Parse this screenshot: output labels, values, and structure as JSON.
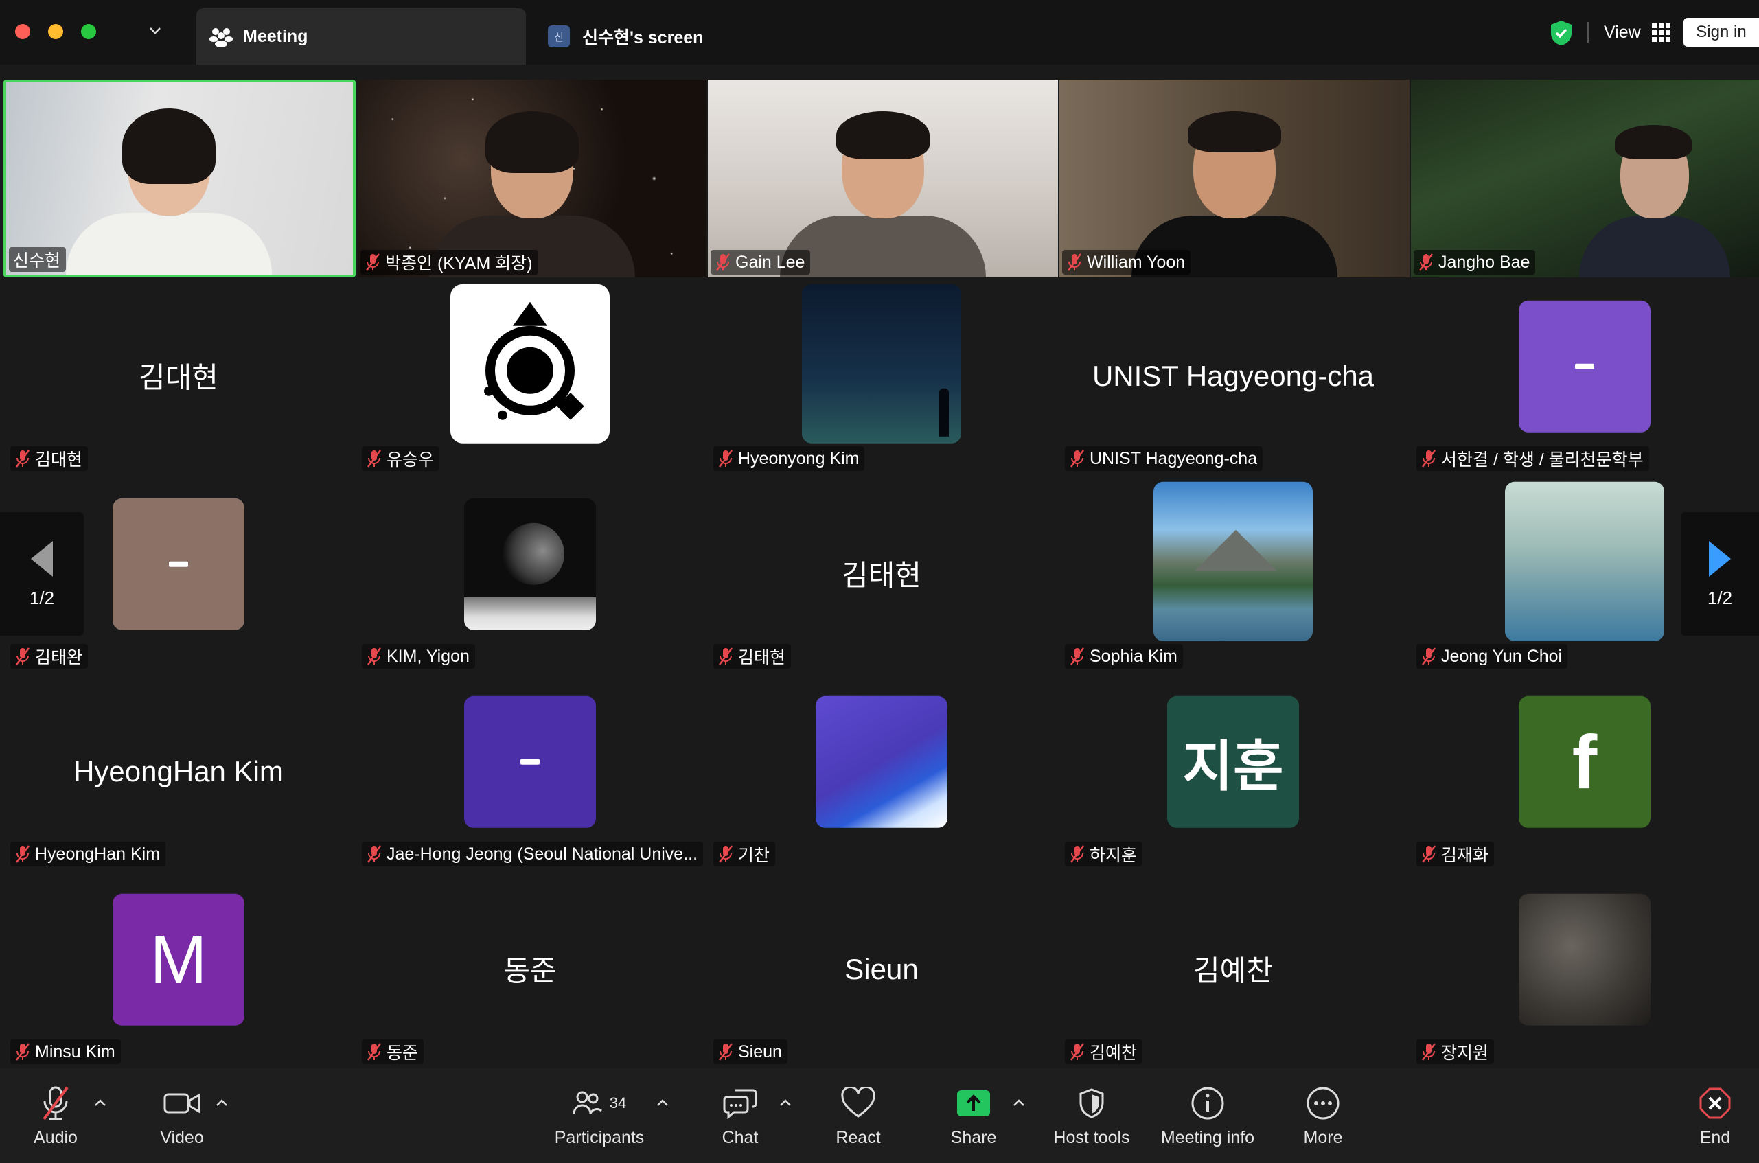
{
  "titlebar": {
    "tabs": [
      {
        "label": "Meeting"
      },
      {
        "label": "신수현's screen",
        "badge": "신"
      }
    ],
    "view_label": "View",
    "signin_label": "Sign in"
  },
  "videos": [
    {
      "name": "신수현",
      "muted": false,
      "active_speaker": true
    },
    {
      "name": "박종인 (KYAM 회장)",
      "muted": true
    },
    {
      "name": "Gain Lee",
      "muted": true
    },
    {
      "name": "William Yoon",
      "muted": true
    },
    {
      "name": "Jangho Bae",
      "muted": true
    }
  ],
  "tiles": [
    {
      "name": "김대현",
      "display": "김대현"
    },
    {
      "name": "유승우",
      "avatar": "logo-target"
    },
    {
      "name": "Hyeonyong Kim",
      "avatar": "night-sky-photo"
    },
    {
      "name": "UNIST Hagyeong-cha",
      "display": "UNIST Hagyeong-cha"
    },
    {
      "name": "서한결 / 학생 / 물리천문학부",
      "avatar_color": "#7b4fc9",
      "avatar_text": "-"
    },
    {
      "name": "김태완",
      "avatar_color": "#8c7266",
      "avatar_text": "-"
    },
    {
      "name": "KIM, Yigon",
      "avatar": "moon-photo"
    },
    {
      "name": "김태현",
      "display": "김태현"
    },
    {
      "name": "Sophia Kim",
      "avatar": "lake-mountain-photo"
    },
    {
      "name": "Jeong Yun Choi",
      "avatar": "mountain-mist-photo"
    },
    {
      "name": "HyeongHan Kim",
      "display": "HyeongHan Kim"
    },
    {
      "name": "Jae-Hong Jeong (Seoul National Unive...",
      "avatar_color": "#4a2fa8",
      "avatar_text": "-"
    },
    {
      "name": "기찬",
      "avatar": "art-illustration"
    },
    {
      "name": "하지훈",
      "avatar_color": "#1e5144",
      "avatar_text": "지훈"
    },
    {
      "name": "김재화",
      "avatar_color": "#3b6a24",
      "avatar_text": "f"
    },
    {
      "name": "Minsu Kim",
      "avatar_color": "#7a2aa6",
      "avatar_text": "M"
    },
    {
      "name": "동준",
      "display": "동준"
    },
    {
      "name": "Sieun",
      "display": "Sieun"
    },
    {
      "name": "김예찬",
      "display": "김예찬"
    },
    {
      "name": "장지원",
      "avatar": "galaxy-photo"
    }
  ],
  "pager": {
    "left": "1/2",
    "right": "1/2"
  },
  "toolbar": {
    "audio": "Audio",
    "video": "Video",
    "participants": "Participants",
    "participants_count": "34",
    "chat": "Chat",
    "react": "React",
    "share": "Share",
    "host_tools": "Host tools",
    "meeting_info": "Meeting info",
    "more": "More",
    "end": "End"
  },
  "colors": {
    "active_speaker_border": "#45d65a",
    "share_green": "#22c55e",
    "end_red": "#e5484d",
    "muted_red": "#e5484d"
  }
}
